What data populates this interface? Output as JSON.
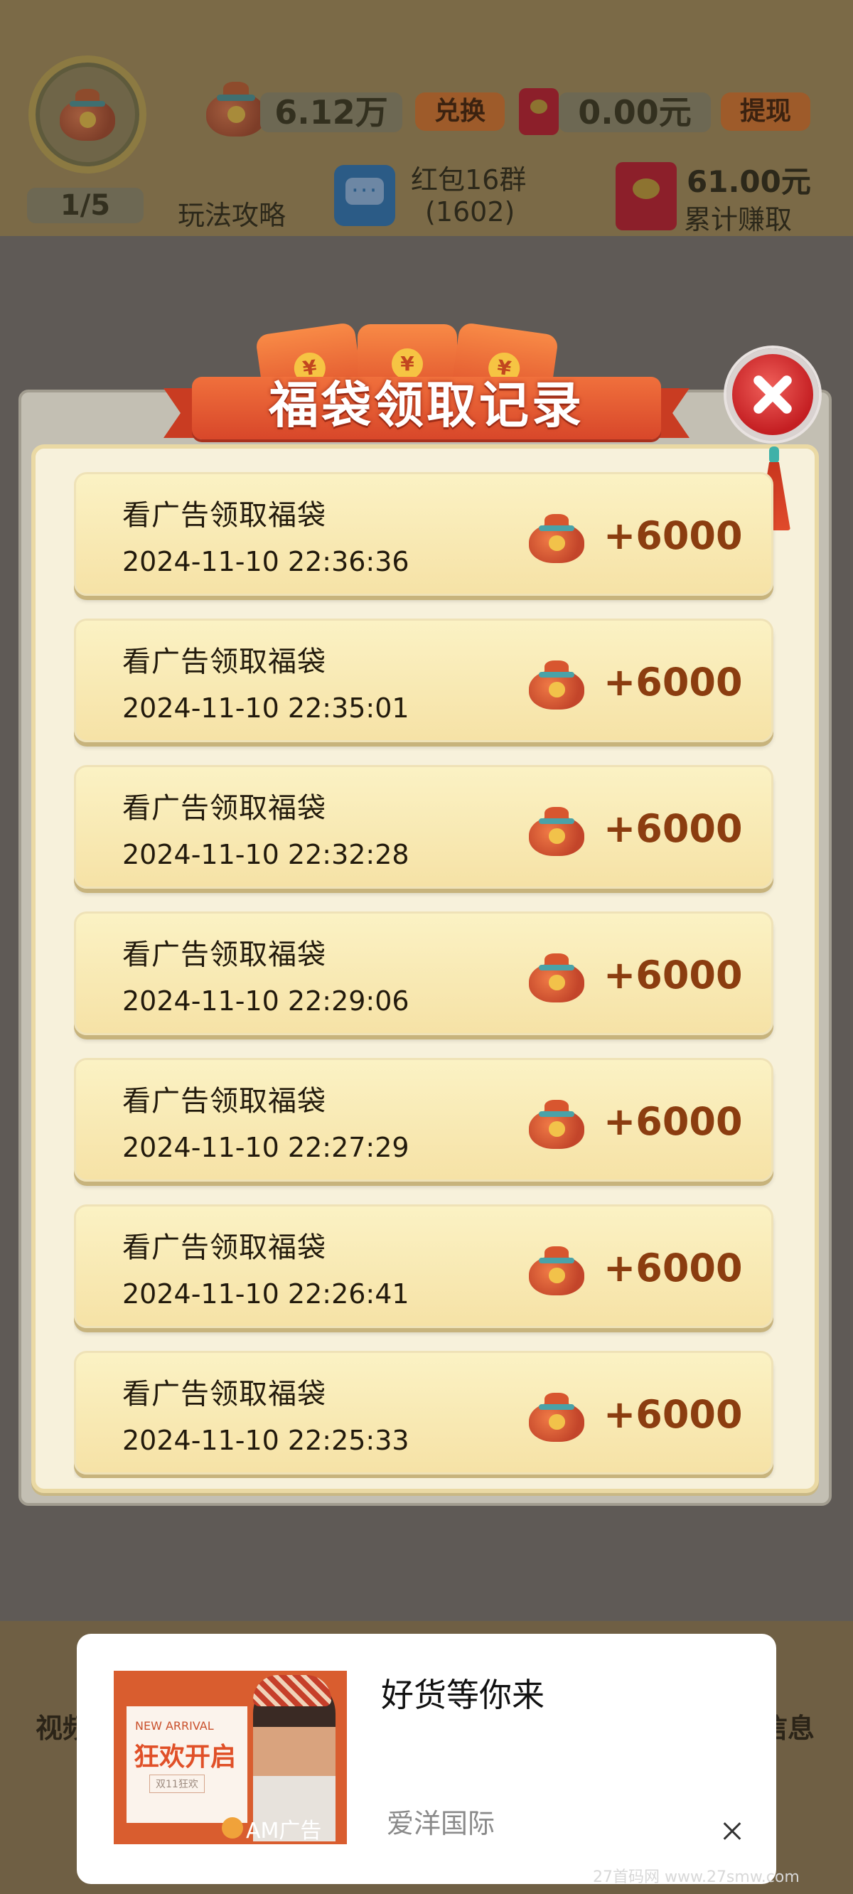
{
  "header": {
    "level_progress": "1/5",
    "coins_value": "6.12万",
    "exchange_label": "兑换",
    "cash_value": "0.00元",
    "withdraw_label": "提现",
    "guide_label": "玩法攻略",
    "group_label": "红包16群",
    "group_count": "(1602)",
    "earned_value": "61.00元",
    "earned_label": "累计赚取"
  },
  "bottom_nav": {
    "left_label": "视频",
    "right_label": "信息"
  },
  "modal": {
    "title": "福袋领取记录",
    "records": [
      {
        "title": "看广告领取福袋",
        "time": "2024-11-10 22:36:36",
        "amount": "+6000"
      },
      {
        "title": "看广告领取福袋",
        "time": "2024-11-10 22:35:01",
        "amount": "+6000"
      },
      {
        "title": "看广告领取福袋",
        "time": "2024-11-10 22:32:28",
        "amount": "+6000"
      },
      {
        "title": "看广告领取福袋",
        "time": "2024-11-10 22:29:06",
        "amount": "+6000"
      },
      {
        "title": "看广告领取福袋",
        "time": "2024-11-10 22:27:29",
        "amount": "+6000"
      },
      {
        "title": "看广告领取福袋",
        "time": "2024-11-10 22:26:41",
        "amount": "+6000"
      },
      {
        "title": "看广告领取福袋",
        "time": "2024-11-10 22:25:33",
        "amount": "+6000"
      }
    ]
  },
  "ad": {
    "title": "好货等你来",
    "brand": "爱洋国际",
    "image_new_arrival": "NEW ARRIVAL",
    "image_promo": "狂欢开启",
    "image_sub": "双11狂欢",
    "image_tag": "AM广告"
  },
  "watermark": "27首码网 www.27smw.com",
  "colors": {
    "card_bg": "#f6e2a6",
    "amount_text": "#8b3d10",
    "ribbon": "#e0532d",
    "close_button": "#c41e22"
  },
  "icons": [
    "lucky-bag-icon",
    "chat-icon",
    "red-envelope-icon",
    "close-icon",
    "tassel-icon"
  ]
}
